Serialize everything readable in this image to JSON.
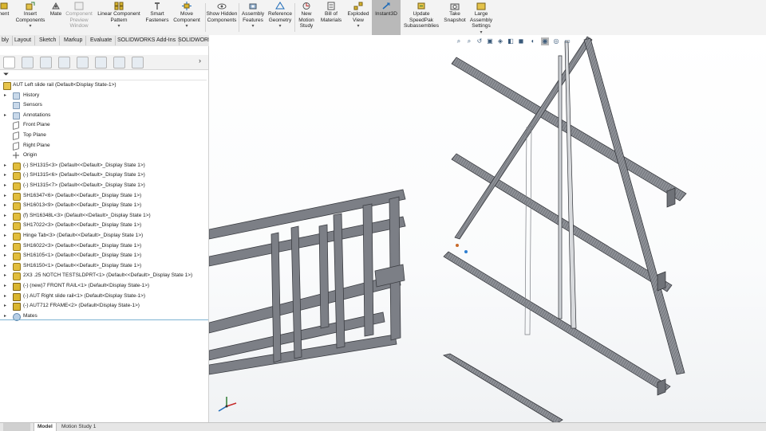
{
  "ribbon": {
    "buttons": [
      {
        "label": "nent",
        "icon": "component-icon"
      },
      {
        "label": "Insert Components",
        "icon": "insert-components-icon"
      },
      {
        "label": "Mate",
        "icon": "mate-icon"
      },
      {
        "label": "Component Preview Window",
        "icon": "preview-window-icon"
      },
      {
        "label": "Linear Component Pattern",
        "icon": "linear-pattern-icon"
      },
      {
        "label": "Smart Fasteners",
        "icon": "smart-fasteners-icon"
      },
      {
        "label": "Move Component",
        "icon": "move-component-icon"
      },
      {
        "label": "Show Hidden Components",
        "icon": "show-hidden-icon"
      },
      {
        "label": "Assembly Features",
        "icon": "assembly-features-icon"
      },
      {
        "label": "Reference Geometry",
        "icon": "reference-geometry-icon"
      },
      {
        "label": "New Motion Study",
        "icon": "motion-study-icon"
      },
      {
        "label": "Bill of Materials",
        "icon": "bom-icon"
      },
      {
        "label": "Exploded View",
        "icon": "exploded-view-icon"
      },
      {
        "label": "Instant3D",
        "icon": "instant3d-icon"
      },
      {
        "label": "Update SpeedPak Subassemblies",
        "icon": "speedpak-icon"
      },
      {
        "label": "Take Snapshot",
        "icon": "snapshot-icon"
      },
      {
        "label": "Large Assembly Settings",
        "icon": "large-assembly-icon"
      }
    ]
  },
  "tabs": [
    "bly",
    "Layout",
    "Sketch",
    "Markup",
    "Evaluate",
    "SOLIDWORKS Add-Ins",
    "SOLIDWORKS CAM"
  ],
  "panel": {
    "icons": [
      "feature-manager-icon",
      "property-manager-icon",
      "configuration-manager-icon",
      "dimxpert-icon",
      "display-manager-icon",
      "cam-feature-icon",
      "cam-operation-icon",
      "cam-tool-icon"
    ]
  },
  "tree": {
    "root": "AUT Left slide rail  (Default<Display State-1>)",
    "items": [
      {
        "label": "History",
        "icon": "folder-icon",
        "expand": "▸"
      },
      {
        "label": "Sensors",
        "icon": "folder-icon",
        "expand": ""
      },
      {
        "label": "Annotations",
        "icon": "folder-icon",
        "expand": "▸"
      },
      {
        "label": "Front Plane",
        "icon": "plane-icon",
        "expand": ""
      },
      {
        "label": "Top Plane",
        "icon": "plane-icon",
        "expand": ""
      },
      {
        "label": "Right Plane",
        "icon": "plane-icon",
        "expand": ""
      },
      {
        "label": "Origin",
        "icon": "origin-icon",
        "expand": ""
      },
      {
        "label": "(-) SH1315<3> (Default<<Default>_Display State 1>)",
        "icon": "part-icon",
        "expand": "▸"
      },
      {
        "label": "(-) SH1315<6> (Default<<Default>_Display State 1>)",
        "icon": "part-icon",
        "expand": "▸"
      },
      {
        "label": "(-) SH1315<7> (Default<<Default>_Display State 1>)",
        "icon": "part-icon",
        "expand": "▸"
      },
      {
        "label": "SH16347<6> (Default<<Default>_Display State 1>)",
        "icon": "part-icon",
        "expand": "▸"
      },
      {
        "label": "SH16013<9> (Default<<Default>_Display State 1>)",
        "icon": "part-icon",
        "expand": "▸"
      },
      {
        "label": "(f) SH16348L<3> (Default<<Default>_Display State 1>)",
        "icon": "part-icon",
        "expand": "▸"
      },
      {
        "label": "SH17022<3> (Default<<Default>_Display State 1>)",
        "icon": "part-icon",
        "expand": "▸"
      },
      {
        "label": "Hinge Tab<3> (Default<<Default>_Display State 1>)",
        "icon": "part-icon",
        "expand": "▸"
      },
      {
        "label": "SH16022<3> (Default<<Default>_Display State 1>)",
        "icon": "part-icon",
        "expand": "▸"
      },
      {
        "label": "SH16105<1> (Default<<Default>_Display State 1>)",
        "icon": "part-icon",
        "expand": "▸"
      },
      {
        "label": "SH16150<1> (Default<<Default>_Display State 1>)",
        "icon": "part-icon",
        "expand": "▸"
      },
      {
        "label": "2X3 .25  NOTCH TESTSLDPRT<1> (Default<<Default>_Display State 1>)",
        "icon": "part-icon",
        "expand": "▸"
      },
      {
        "label": "(-) (new)7 FRONT RAIL<1> (Default<Display State-1>)",
        "icon": "assembly-icon",
        "expand": "▸"
      },
      {
        "label": "(-) AUT Right slide rail<1> (Default<Display State-1>)",
        "icon": "assembly-icon",
        "expand": "▸"
      },
      {
        "label": "(-) AUT712 FRAME<2> (Default<Display State-1>)",
        "icon": "assembly-icon",
        "expand": "▸"
      },
      {
        "label": "Mates",
        "icon": "mates-icon",
        "expand": "▸"
      }
    ]
  },
  "bottom_tabs": [
    "Model",
    "Motion Study 1"
  ],
  "colors": {
    "accent": "#7eb3d3",
    "ribbon_bg": "#f3f3f3",
    "active_button": "#b9b9b9",
    "part_icon": "#e1bd3c",
    "model_steel": "#7c7f86"
  }
}
